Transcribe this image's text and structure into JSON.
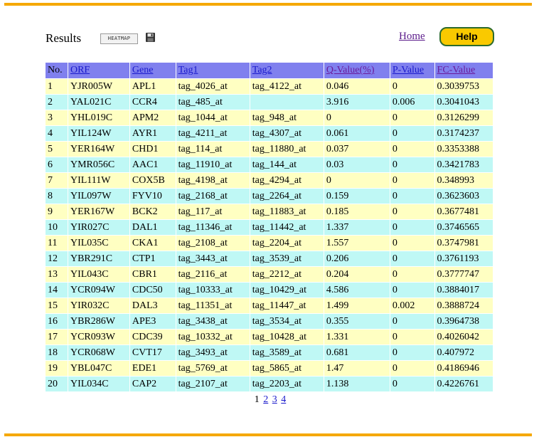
{
  "header": {
    "title": "Results",
    "heatmap_label": "HEATMAP",
    "save_icon": "floppy-disk-icon",
    "home_label": "Home",
    "help_label": "Help"
  },
  "colors": {
    "accent_bar": "#f5a800",
    "table_header": "#8080ee",
    "row_odd": "#ffffc2",
    "row_even": "#bff8f5",
    "help_button": "#f9c900"
  },
  "table": {
    "columns": [
      "No.",
      "ORF",
      "Gene",
      "Tag1",
      "Tag2",
      "Q-Value(%)",
      "P-Value",
      "FC-Value"
    ],
    "rows": [
      [
        "1",
        "YJR005W",
        "APL1",
        "tag_4026_at",
        "tag_4122_at",
        "0.046",
        "0",
        "0.3039753"
      ],
      [
        "2",
        "YAL021C",
        "CCR4",
        "tag_485_at",
        "",
        "3.916",
        "0.006",
        "0.3041043"
      ],
      [
        "3",
        "YHL019C",
        "APM2",
        "tag_1044_at",
        "tag_948_at",
        "0",
        "0",
        "0.3126299"
      ],
      [
        "4",
        "YIL124W",
        "AYR1",
        "tag_4211_at",
        "tag_4307_at",
        "0.061",
        "0",
        "0.3174237"
      ],
      [
        "5",
        "YER164W",
        "CHD1",
        "tag_114_at",
        "tag_11880_at",
        "0.037",
        "0",
        "0.3353388"
      ],
      [
        "6",
        "YMR056C",
        "AAC1",
        "tag_11910_at",
        "tag_144_at",
        "0.03",
        "0",
        "0.3421783"
      ],
      [
        "7",
        "YIL111W",
        "COX5B",
        "tag_4198_at",
        "tag_4294_at",
        "0",
        "0",
        "0.348993"
      ],
      [
        "8",
        "YIL097W",
        "FYV10",
        "tag_2168_at",
        "tag_2264_at",
        "0.159",
        "0",
        "0.3623603"
      ],
      [
        "9",
        "YER167W",
        "BCK2",
        "tag_117_at",
        "tag_11883_at",
        "0.185",
        "0",
        "0.3677481"
      ],
      [
        "10",
        "YIR027C",
        "DAL1",
        "tag_11346_at",
        "tag_11442_at",
        "1.337",
        "0",
        "0.3746565"
      ],
      [
        "11",
        "YIL035C",
        "CKA1",
        "tag_2108_at",
        "tag_2204_at",
        "1.557",
        "0",
        "0.3747981"
      ],
      [
        "12",
        "YBR291C",
        "CTP1",
        "tag_3443_at",
        "tag_3539_at",
        "0.206",
        "0",
        "0.3761193"
      ],
      [
        "13",
        "YIL043C",
        "CBR1",
        "tag_2116_at",
        "tag_2212_at",
        "0.204",
        "0",
        "0.3777747"
      ],
      [
        "14",
        "YCR094W",
        "CDC50",
        "tag_10333_at",
        "tag_10429_at",
        "4.586",
        "0",
        "0.3884017"
      ],
      [
        "15",
        "YIR032C",
        "DAL3",
        "tag_11351_at",
        "tag_11447_at",
        "1.499",
        "0.002",
        "0.3888724"
      ],
      [
        "16",
        "YBR286W",
        "APE3",
        "tag_3438_at",
        "tag_3534_at",
        "0.355",
        "0",
        "0.3964738"
      ],
      [
        "17",
        "YCR093W",
        "CDC39",
        "tag_10332_at",
        "tag_10428_at",
        "1.331",
        "0",
        "0.4026042"
      ],
      [
        "18",
        "YCR068W",
        "CVT17",
        "tag_3493_at",
        "tag_3589_at",
        "0.681",
        "0",
        "0.407972"
      ],
      [
        "19",
        "YBL047C",
        "EDE1",
        "tag_5769_at",
        "tag_5865_at",
        "1.47",
        "0",
        "0.4186946"
      ],
      [
        "20",
        "YIL034C",
        "CAP2",
        "tag_2107_at",
        "tag_2203_at",
        "1.138",
        "0",
        "0.4226761"
      ]
    ]
  },
  "pagination": {
    "current": "1",
    "pages": [
      "2",
      "3",
      "4"
    ]
  }
}
